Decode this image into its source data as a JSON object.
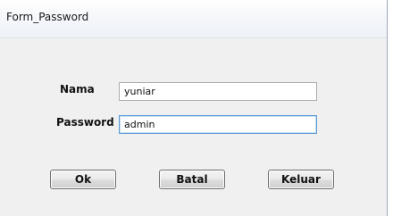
{
  "window": {
    "title": "Form_Password"
  },
  "form": {
    "nama_label": "Nama",
    "nama_value": "yuniar",
    "password_label": "Password",
    "password_value": "admin"
  },
  "buttons": {
    "ok_label": "Ok",
    "batal_label": "Batal",
    "keluar_label": "Keluar"
  }
}
